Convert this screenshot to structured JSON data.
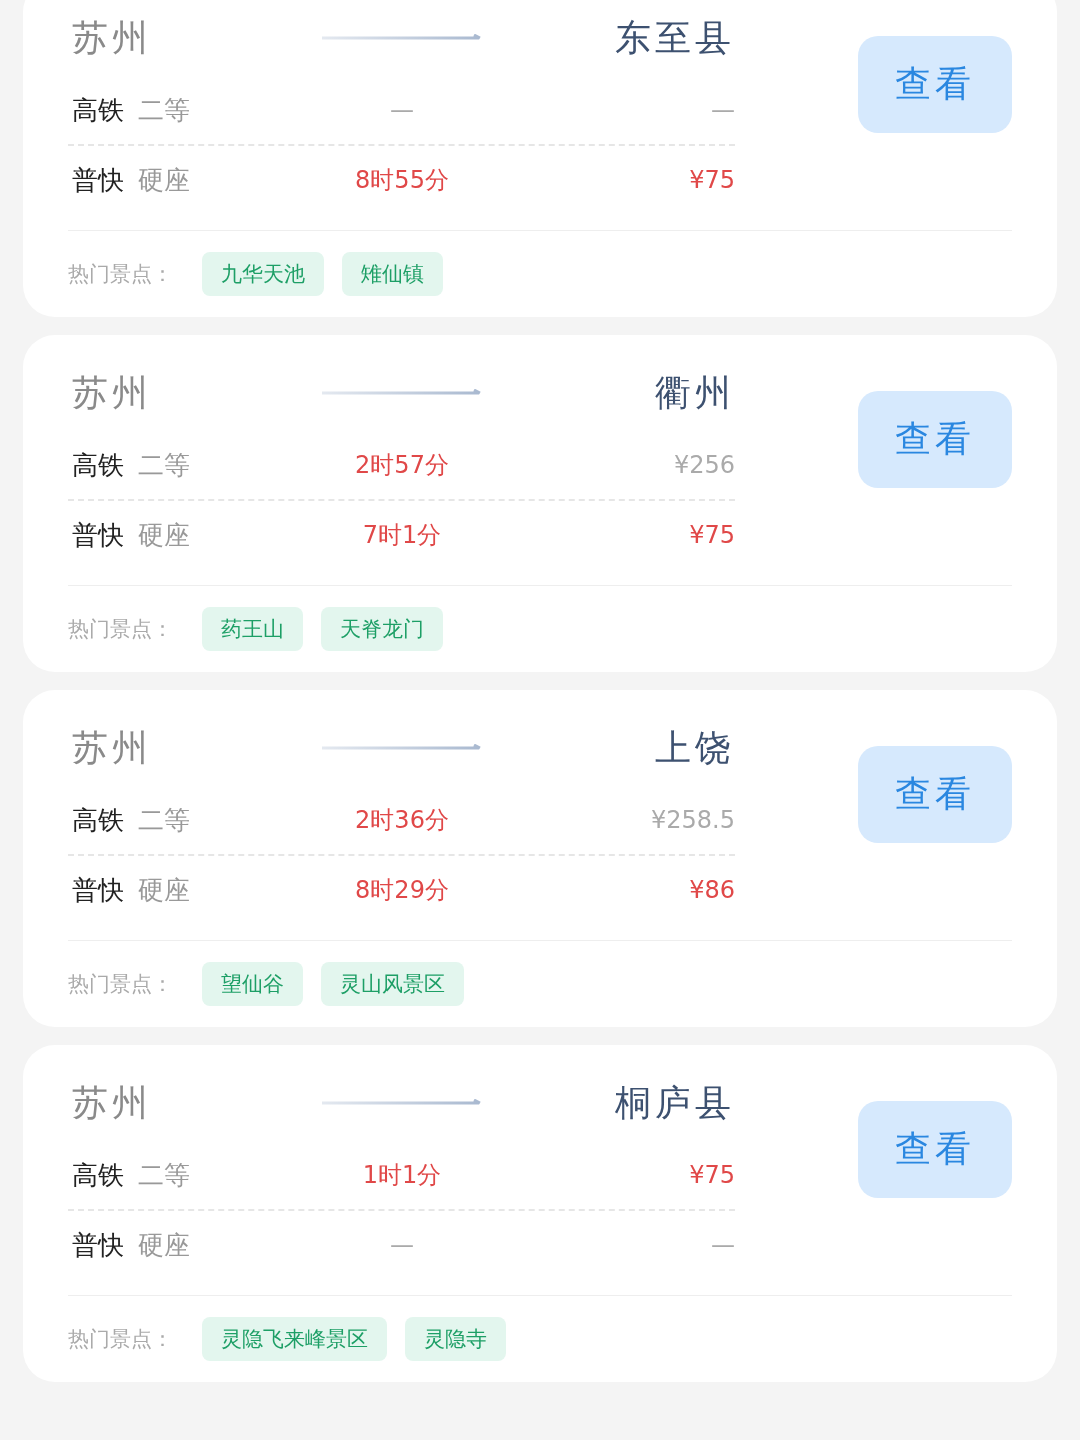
{
  "cards": [
    {
      "origin": "苏州",
      "destination": "东至县",
      "button": "查看",
      "trains": [
        {
          "type": "高铁",
          "seat": "二等",
          "duration": "—",
          "duration_highlight": false,
          "price": "—",
          "price_highlight": false
        },
        {
          "type": "普快",
          "seat": "硬座",
          "duration": "8时55分",
          "duration_highlight": true,
          "price": "¥75",
          "price_highlight": true
        }
      ],
      "spots_label": "热门景点：",
      "spots": [
        "九华天池",
        "雉仙镇"
      ]
    },
    {
      "origin": "苏州",
      "destination": "衢州",
      "button": "查看",
      "trains": [
        {
          "type": "高铁",
          "seat": "二等",
          "duration": "2时57分",
          "duration_highlight": true,
          "price": "¥256",
          "price_highlight": false
        },
        {
          "type": "普快",
          "seat": "硬座",
          "duration": "7时1分",
          "duration_highlight": true,
          "price": "¥75",
          "price_highlight": true
        }
      ],
      "spots_label": "热门景点：",
      "spots": [
        "药王山",
        "天脊龙门"
      ]
    },
    {
      "origin": "苏州",
      "destination": "上饶",
      "button": "查看",
      "trains": [
        {
          "type": "高铁",
          "seat": "二等",
          "duration": "2时36分",
          "duration_highlight": true,
          "price": "¥258.5",
          "price_highlight": false
        },
        {
          "type": "普快",
          "seat": "硬座",
          "duration": "8时29分",
          "duration_highlight": true,
          "price": "¥86",
          "price_highlight": true
        }
      ],
      "spots_label": "热门景点：",
      "spots": [
        "望仙谷",
        "灵山风景区"
      ]
    },
    {
      "origin": "苏州",
      "destination": "桐庐县",
      "button": "查看",
      "trains": [
        {
          "type": "高铁",
          "seat": "二等",
          "duration": "1时1分",
          "duration_highlight": true,
          "price": "¥75",
          "price_highlight": true
        },
        {
          "type": "普快",
          "seat": "硬座",
          "duration": "—",
          "duration_highlight": false,
          "price": "—",
          "price_highlight": false
        }
      ],
      "spots_label": "热门景点：",
      "spots": [
        "灵隐飞来峰景区",
        "灵隐寺"
      ]
    }
  ]
}
